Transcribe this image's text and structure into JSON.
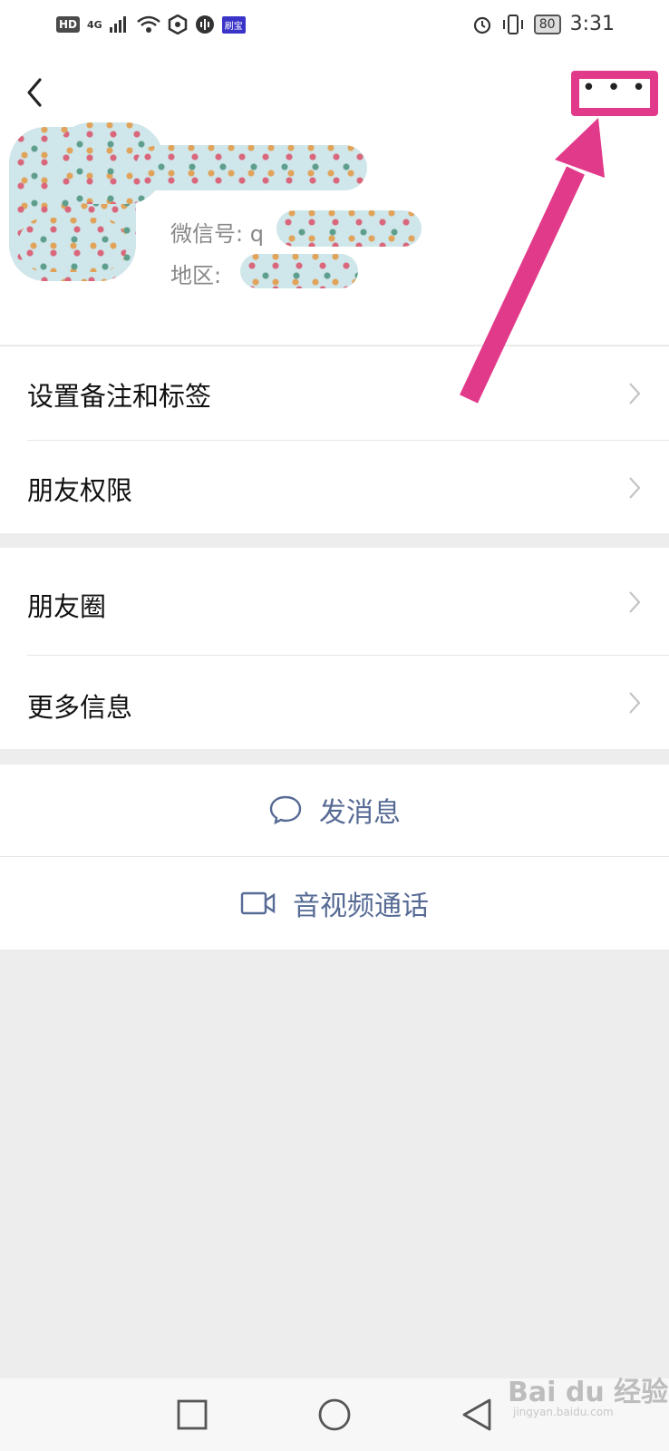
{
  "status_bar": {
    "left_items": [
      "HD",
      "4G",
      "signal",
      "wifi",
      "app1",
      "app2",
      "app-badge"
    ],
    "hd_label": "HD",
    "net_label": "4G",
    "app_badge": "刷宝",
    "battery": "80",
    "time": "3:31"
  },
  "profile": {
    "wechat_id_label": "微信号:",
    "wechat_id_value": "q",
    "region_label": "地区:"
  },
  "list1": [
    {
      "label": "设置备注和标签"
    },
    {
      "label": "朋友权限"
    }
  ],
  "list2": [
    {
      "label": "朋友圈"
    },
    {
      "label": "更多信息"
    }
  ],
  "actions": {
    "send_message": "发消息",
    "video_call": "音视频通话"
  },
  "colors": {
    "accent_link": "#576b95",
    "annotation": "#e23a8a",
    "background": "#ededed"
  },
  "icons": {
    "back": "chevron-left-icon",
    "more": "more-dots-icon",
    "message": "chat-bubble-icon",
    "video": "video-camera-icon"
  },
  "watermark": {
    "brand": "Bai du 经验",
    "url": "jingyan.baidu.com"
  }
}
